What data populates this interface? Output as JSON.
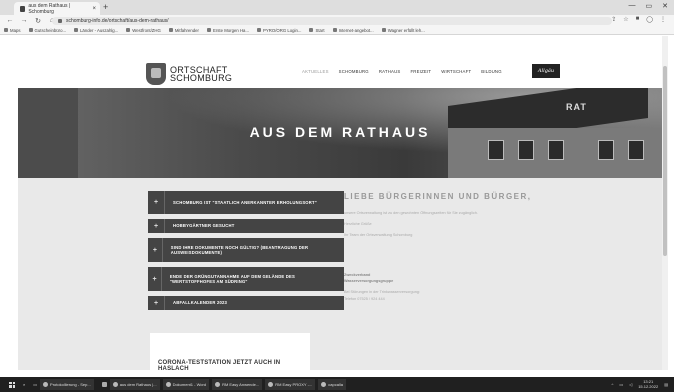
{
  "browser": {
    "tab_title": "aus dem Rathaus | Schomburg",
    "tab_close": "×",
    "new_tab": "+",
    "url": "schomburg-info.de/ortschaft/aus-dem-rathaus/",
    "bookmarks": [
      "Maps",
      "Gutscheinbüro...",
      "Länder - Auszahlg...",
      "Westfront/ZHG",
      "Mitfahrender",
      "Erste Morgen Ha...",
      "PYRO/ORG Login...",
      "Start",
      "Internet-angebot...",
      "Wagner erfüllt leh..."
    ],
    "window_controls": [
      "—",
      "▭",
      "✕"
    ]
  },
  "site": {
    "logo_line1": "ORTSCHAFT",
    "logo_line2": "SCHOMBURG",
    "menu": [
      "AKTUELLES",
      "SCHOMBURG",
      "RATHAUS",
      "FREIZEIT",
      "WIRTSCHAFT",
      "BILDUNG"
    ],
    "allgaeu": "Allgäu",
    "hero_title": "AUS DEM RATHAUS",
    "hero_sign": "RAT",
    "accordion": [
      "SCHOMBURG IST \"STAATLICH ANERKANNTER ERHOLUNGSORT\"",
      "HOBBYGÄRTNER GESUCHT",
      "SIND IHRE DOKUMENTE NOCH GÜLTIG? (BEANTRAGUNG DER AUSWEISDOKUMENTE)",
      "ENDE DER GRÜNGUTANNAHME AUF DEM GELÄNDE DES \"WERTSTOFFHOFES AM SÜDRING\"",
      "ABFALLKALENDER 2023"
    ],
    "acc_symbol": "+",
    "greeting_title": "LIEBE BÜRGERINNEN UND BÜRGER,",
    "greeting_lines": [
      "unsere Ortsverwaltung ist zu den gewohnten Öffnungszeiten für Sie zugänglich.",
      "Herzliche Grüße",
      "Ihr Team der Ortsverwaltung Schomburg"
    ],
    "contact_bold_1": "Zweckverband",
    "contact_bold_2": "Wasserversorgungsgruppe",
    "contact_lines": [
      "Bei Störungen in der Trinkwasserversorgung:",
      "Telefon 07525 / 924 444"
    ],
    "card_title": "CORONA-TESTSTATION JETZT AUCH IN HASLACH"
  },
  "taskbar": {
    "apps": [
      "Protokollierung - Sep...",
      "aus dem Rathaus |...",
      "Dokument1 - Word",
      "RM Easy Anwende...",
      "RM Easy PROXY -...",
      "capcalla"
    ],
    "time": "13:21",
    "date": "15.12.2022"
  }
}
